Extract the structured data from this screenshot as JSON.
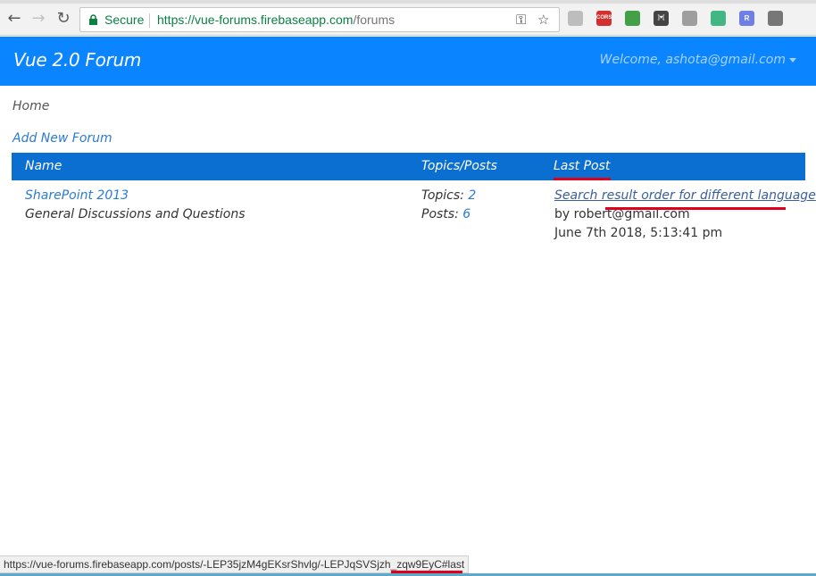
{
  "browser": {
    "secure_label": "Secure",
    "url_host": "https://vue-forums.firebaseapp.com",
    "url_path": "/forums",
    "status_url": "https://vue-forums.firebaseapp.com/posts/-LEP35jzM4gEKsrShvlg/-LEPJqSVSjzh_zqw9EyC#last",
    "extensions": [
      {
        "icon": "document-icon",
        "label": "",
        "color": "#bdbdbd"
      },
      {
        "icon": "cors-icon",
        "label": "CORS",
        "color": "#d32f2f"
      },
      {
        "icon": "toggle-icon",
        "label": "",
        "color": "#43a047"
      },
      {
        "icon": "bracket-icon",
        "label": "]♥[",
        "color": "#444444"
      },
      {
        "icon": "hexagon-icon",
        "label": "",
        "color": "#9e9e9e"
      },
      {
        "icon": "vue-devtools-icon",
        "label": "",
        "color": "#41b883"
      },
      {
        "icon": "r-icon",
        "label": "R",
        "color": "#6f7fe8"
      },
      {
        "icon": "square-icon",
        "label": "",
        "color": "#777777"
      }
    ]
  },
  "header": {
    "brand": "Vue 2.0 Forum",
    "welcome": "Welcome, ashota@gmail.com"
  },
  "breadcrumb": "Home",
  "add_forum_label": "Add New Forum",
  "table": {
    "columns": [
      "Name",
      "Topics/Posts",
      "Last Post"
    ],
    "rows": [
      {
        "forum_name": "SharePoint 2013",
        "description": "General Discussions and Questions",
        "topics_label": "Topics:",
        "topics_count": "2",
        "posts_label": "Posts:",
        "posts_count": "6",
        "last_post_title": "Search result order for different language",
        "last_post_author": "by robert@gmail.com",
        "last_post_date": "June 7th 2018, 5:13:41 pm"
      }
    ]
  },
  "colors": {
    "header_bg": "#0a84ff",
    "table_head_bg": "#0a6fd1",
    "link": "#2a7bd6",
    "annotation_red": "#e0001b"
  }
}
